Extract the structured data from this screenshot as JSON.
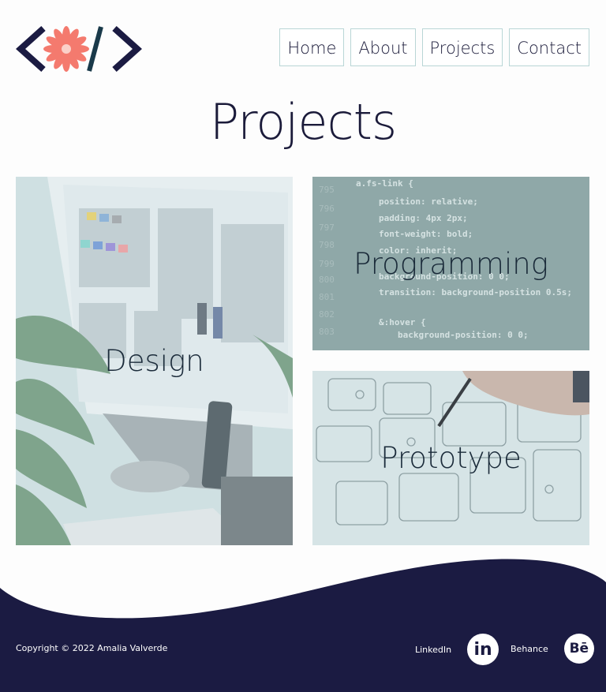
{
  "nav": {
    "items": [
      {
        "label": "Home"
      },
      {
        "label": "About"
      },
      {
        "label": "Projects"
      },
      {
        "label": "Contact"
      }
    ]
  },
  "page": {
    "title": "Projects"
  },
  "cards": [
    {
      "label": "Design"
    },
    {
      "label": "Programming"
    },
    {
      "label": "Prototype"
    }
  ],
  "footer": {
    "copyright": "Copyright © 2022 Amalia Valverde",
    "social": [
      {
        "label": "LinkedIn",
        "icon_text": "in",
        "icon": "linkedin-icon"
      },
      {
        "label": "Behance",
        "icon_text": "Bē",
        "icon": "behance-icon"
      }
    ]
  },
  "code_snippet": [
    "a.fs-link {",
    "position: relative;",
    "padding: 4px 2px;",
    "font-weight: bold;",
    "color: inherit;",
    "background-position: 0 0;",
    "transition: background-position 0.5s;",
    "&:hover {",
    "background-position: 0 0;"
  ],
  "colors": {
    "navy": "#1b1b42",
    "accent": "#f47a6e",
    "nav_border": "#b9d6d6",
    "card_overlay": "#b7d5d6"
  }
}
